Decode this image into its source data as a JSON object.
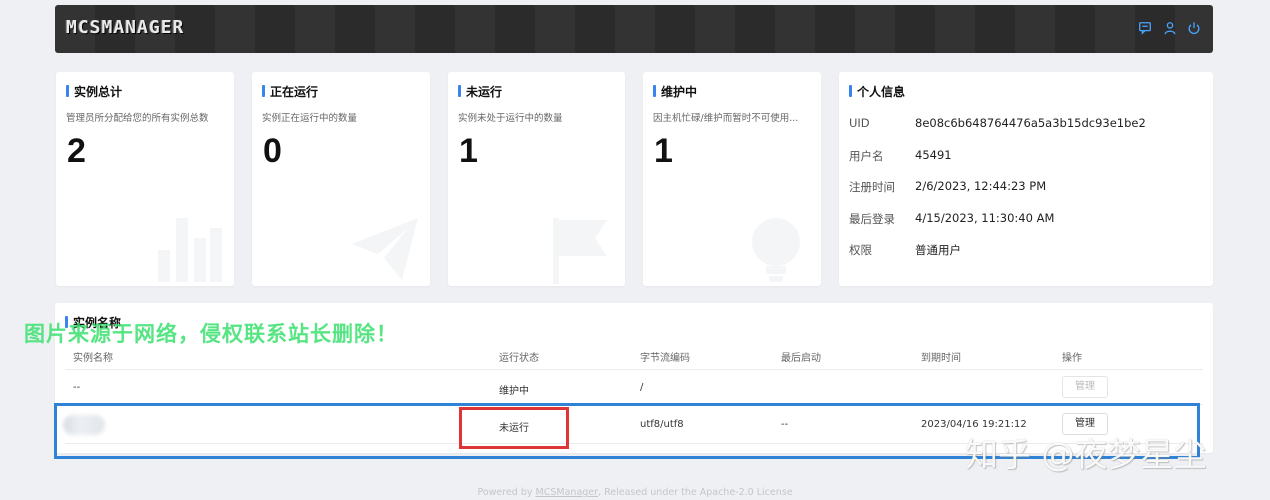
{
  "header": {
    "logo": "MCSMANAGER",
    "icons": [
      "chat-icon",
      "user-icon",
      "power-icon"
    ]
  },
  "stats": [
    {
      "title": "实例总计",
      "desc": "管理员所分配给您的所有实例总数",
      "value": "2",
      "bg_icon": "bar-chart-icon"
    },
    {
      "title": "正在运行",
      "desc": "实例正在运行中的数量",
      "value": "0",
      "bg_icon": "paper-plane-icon"
    },
    {
      "title": "未运行",
      "desc": "实例未处于运行中的数量",
      "value": "1",
      "bg_icon": "flag-icon"
    },
    {
      "title": "维护中",
      "desc": "因主机忙碌/维护而暂时不可使用...",
      "value": "1",
      "bg_icon": "bulb-icon"
    }
  ],
  "profile": {
    "title": "个人信息",
    "rows": [
      {
        "label": "UID",
        "value": "8e08c6b648764476a5a3b15dc93e1be2"
      },
      {
        "label": "用户名",
        "value": "45491"
      },
      {
        "label": "注册时间",
        "value": "2/6/2023, 12:44:23 PM"
      },
      {
        "label": "最后登录",
        "value": "4/15/2023, 11:30:40 AM"
      },
      {
        "label": "权限",
        "value": "普通用户"
      }
    ]
  },
  "instances": {
    "title": "实例名称",
    "columns": [
      "实例名称",
      "运行状态",
      "字节流编码",
      "最后启动",
      "到期时间",
      "操作"
    ],
    "rows": [
      {
        "name": "--",
        "status": "维护中",
        "encoding": "/",
        "last_start": "",
        "expire": "",
        "action": "管理"
      },
      {
        "name": "",
        "status": "未运行",
        "encoding": "utf8/utf8",
        "last_start": "--",
        "expire": "2023/04/16 19:21:12",
        "action": "管理"
      }
    ]
  },
  "watermarks": {
    "green": "图片来源于网络，侵权联系站长删除！",
    "zhihu": "知乎 @夜梦星尘"
  },
  "footer": {
    "prefix": "Powered by ",
    "link": "MCSManager",
    "suffix": ", Released under the Apache-2.0 License"
  },
  "colors": {
    "accent": "#3a84f0",
    "highlight_blue": "#2f82d6",
    "highlight_red": "#e03535",
    "header_bg": "#2b2b2b"
  }
}
